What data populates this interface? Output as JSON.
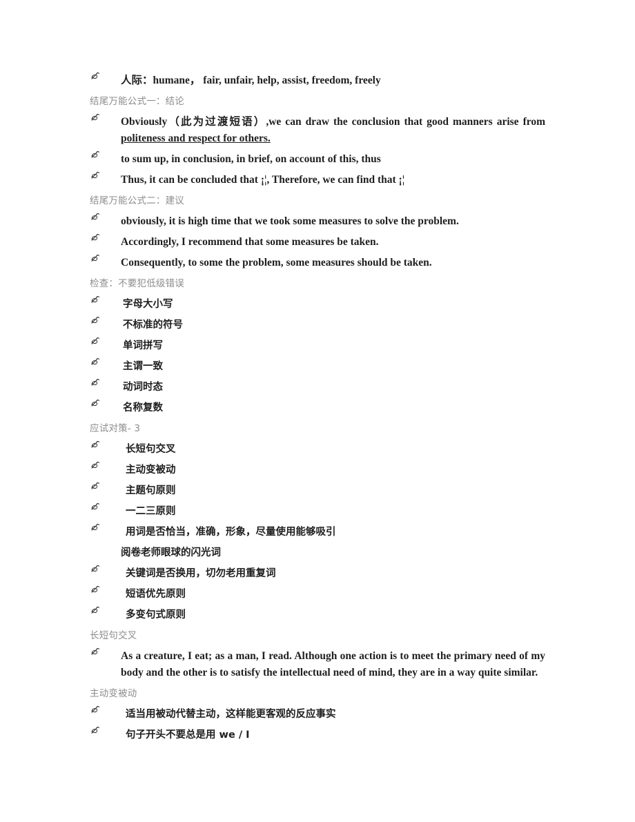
{
  "document": {
    "bullet_icon": "pen-flourish-icon",
    "heading_color": "#8d8d8d",
    "text_color": "#262626",
    "background": "#ffffff"
  },
  "blocks": [
    {
      "type": "bullet",
      "indent": 0,
      "script": "mixed",
      "text": "人际：humane，  fair, unfair, help, assist, freedom, freely"
    },
    {
      "type": "heading",
      "text": "结尾万能公式一：结论"
    },
    {
      "type": "bullet-paragraph",
      "indent": 0,
      "text_before": "Obviously（此为过渡短语）,we can draw the conclusion that good manners arise from ",
      "text_underlined": "politeness and respect for others."
    },
    {
      "type": "bullet",
      "indent": 0,
      "script": "en",
      "text": "to sum up, in conclusion, in brief, on account of this, thus"
    },
    {
      "type": "bullet",
      "indent": 0,
      "script": "en",
      "text": "Thus, it can be concluded that ¡¦, Therefore, we can find that ¡¦"
    },
    {
      "type": "heading",
      "text": "结尾万能公式二：建议"
    },
    {
      "type": "bullet",
      "indent": 0,
      "script": "en",
      "text": "obviously, it is high time that we took some measures to solve the problem."
    },
    {
      "type": "bullet",
      "indent": 0,
      "script": "en",
      "text": "Accordingly, I recommend that some measures be taken."
    },
    {
      "type": "bullet",
      "indent": 0,
      "script": "en",
      "text": "Consequently, to some the problem, some measures should be taken."
    },
    {
      "type": "heading",
      "text": "检查：不要犯低级错误"
    },
    {
      "type": "bullet",
      "indent": 1,
      "script": "cn",
      "text": "字母大小写"
    },
    {
      "type": "bullet",
      "indent": 1,
      "script": "cn",
      "text": "不标准的符号"
    },
    {
      "type": "bullet",
      "indent": 1,
      "script": "cn",
      "text": "单词拼写"
    },
    {
      "type": "bullet",
      "indent": 1,
      "script": "cn",
      "text": "主谓一致"
    },
    {
      "type": "bullet",
      "indent": 1,
      "script": "cn",
      "text": "动词时态"
    },
    {
      "type": "bullet",
      "indent": 1,
      "script": "cn",
      "text": "名称复数"
    },
    {
      "type": "heading",
      "text": "应试对策- 3"
    },
    {
      "type": "bullet",
      "indent": 2,
      "script": "cnbold",
      "text": "长短句交叉"
    },
    {
      "type": "bullet",
      "indent": 2,
      "script": "cnbold",
      "text": "主动变被动"
    },
    {
      "type": "bullet",
      "indent": 2,
      "script": "cnbold",
      "text": "主题句原则"
    },
    {
      "type": "bullet",
      "indent": 2,
      "script": "cnbold",
      "text": "一二三原则"
    },
    {
      "type": "bullet-wrapped",
      "indent": 2,
      "script": "cnbold",
      "text": "用词是否恰当，准确，形象，尽量使用能够吸引",
      "continuation": "阅卷老师眼球的闪光词"
    },
    {
      "type": "bullet",
      "indent": 2,
      "script": "cnbold",
      "text": "关键词是否换用，切勿老用重复词"
    },
    {
      "type": "bullet",
      "indent": 2,
      "script": "cnbold",
      "text": "短语优先原则"
    },
    {
      "type": "bullet",
      "indent": 2,
      "script": "cnbold",
      "text": "多变句式原则"
    },
    {
      "type": "heading",
      "text": "长短句交叉"
    },
    {
      "type": "bullet-paragraph-plain",
      "indent": 0,
      "text": "As a creature, I eat; as a man, I read. Although one action is to meet the primary need of my body and the other is to satisfy the intellectual need of mind, they are in a way quite similar."
    },
    {
      "type": "heading",
      "text": "主动变被动"
    },
    {
      "type": "bullet",
      "indent": 2,
      "script": "cn",
      "text": "适当用被动代替主动，这样能更客观的反应事实"
    },
    {
      "type": "bullet",
      "indent": 2,
      "script": "cn",
      "text": "句子开头不要总是用 we / I"
    }
  ]
}
